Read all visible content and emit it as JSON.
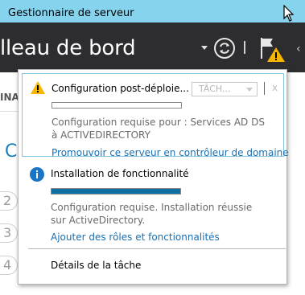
{
  "window": {
    "title": "Gestionnaire de serveur"
  },
  "header": {
    "title": "lleau de bord",
    "next_label": "‹"
  },
  "background": {
    "tab_label": "INA",
    "section_initial": "C",
    "steps": [
      "2",
      "3",
      "4"
    ]
  },
  "notifications": [
    {
      "type": "warning",
      "icon": "warning-icon",
      "title": "Configuration post-déploie...",
      "task_select_value": "TÂCH...",
      "close_label": "x",
      "progress": 0,
      "description": "Configuration requise pour : Services AD DS à ACTIVEDIRECTORY",
      "link": "Promouvoir ce serveur en contrôleur de domaine"
    },
    {
      "type": "info",
      "icon": "info-icon",
      "title": "Installation de fonctionnalité",
      "progress": 1.0,
      "description": "Configuration requise. Installation réussie sur ActiveDirectory.",
      "link": "Ajouter des rôles et fonctionnalités"
    }
  ],
  "footer": {
    "details_label": "Détails de la tâche"
  },
  "colors": {
    "titlebar": "#86d3ee",
    "header": "#2d2d30",
    "link": "#1a6fb0",
    "progress_fill": "#0f6fa1",
    "warning": "#f7b500",
    "info": "#1b75c7"
  }
}
